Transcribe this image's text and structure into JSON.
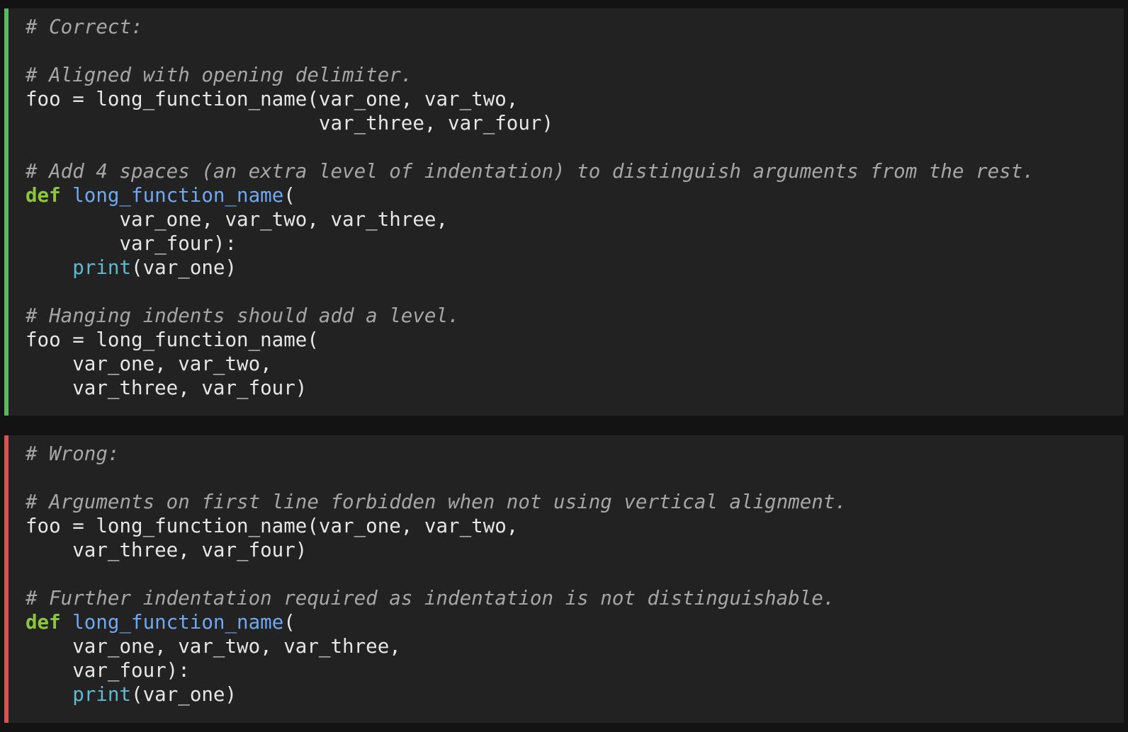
{
  "colors": {
    "page_background": "#131313",
    "block_background": "#222222",
    "correct_bar": "#5cb85c",
    "wrong_bar": "#d9534f",
    "comment": "#a6a6a6",
    "keyword": "#8cc63f",
    "function_name": "#6fa8f0",
    "builtin": "#5fb9cf",
    "text": "#e6e6e6"
  },
  "blocks": [
    {
      "id": "correct",
      "lines": [
        [
          {
            "t": "cm",
            "s": "# Correct:"
          }
        ],
        [],
        [
          {
            "t": "cm",
            "s": "# Aligned with opening delimiter."
          }
        ],
        [
          {
            "t": "plain",
            "s": "foo = long_function_name(var_one, var_two,"
          }
        ],
        [
          {
            "t": "plain",
            "s": "                         var_three, var_four)"
          }
        ],
        [],
        [
          {
            "t": "cm",
            "s": "# Add 4 spaces (an extra level of indentation) to distinguish arguments from the rest."
          }
        ],
        [
          {
            "t": "kw",
            "s": "def"
          },
          {
            "t": "plain",
            "s": " "
          },
          {
            "t": "fn",
            "s": "long_function_name"
          },
          {
            "t": "plain",
            "s": "("
          }
        ],
        [
          {
            "t": "plain",
            "s": "        var_one, var_two, var_three,"
          }
        ],
        [
          {
            "t": "plain",
            "s": "        var_four):"
          }
        ],
        [
          {
            "t": "plain",
            "s": "    "
          },
          {
            "t": "bi",
            "s": "print"
          },
          {
            "t": "plain",
            "s": "(var_one)"
          }
        ],
        [],
        [
          {
            "t": "cm",
            "s": "# Hanging indents should add a level."
          }
        ],
        [
          {
            "t": "plain",
            "s": "foo = long_function_name("
          }
        ],
        [
          {
            "t": "plain",
            "s": "    var_one, var_two,"
          }
        ],
        [
          {
            "t": "plain",
            "s": "    var_three, var_four)"
          }
        ]
      ]
    },
    {
      "id": "wrong",
      "lines": [
        [
          {
            "t": "cm",
            "s": "# Wrong:"
          }
        ],
        [],
        [
          {
            "t": "cm",
            "s": "# Arguments on first line forbidden when not using vertical alignment."
          }
        ],
        [
          {
            "t": "plain",
            "s": "foo = long_function_name(var_one, var_two,"
          }
        ],
        [
          {
            "t": "plain",
            "s": "    var_three, var_four)"
          }
        ],
        [],
        [
          {
            "t": "cm",
            "s": "# Further indentation required as indentation is not distinguishable."
          }
        ],
        [
          {
            "t": "kw",
            "s": "def"
          },
          {
            "t": "plain",
            "s": " "
          },
          {
            "t": "fn",
            "s": "long_function_name"
          },
          {
            "t": "plain",
            "s": "("
          }
        ],
        [
          {
            "t": "plain",
            "s": "    var_one, var_two, var_three,"
          }
        ],
        [
          {
            "t": "plain",
            "s": "    var_four):"
          }
        ],
        [
          {
            "t": "plain",
            "s": "    "
          },
          {
            "t": "bi",
            "s": "print"
          },
          {
            "t": "plain",
            "s": "(var_one)"
          }
        ]
      ]
    }
  ]
}
